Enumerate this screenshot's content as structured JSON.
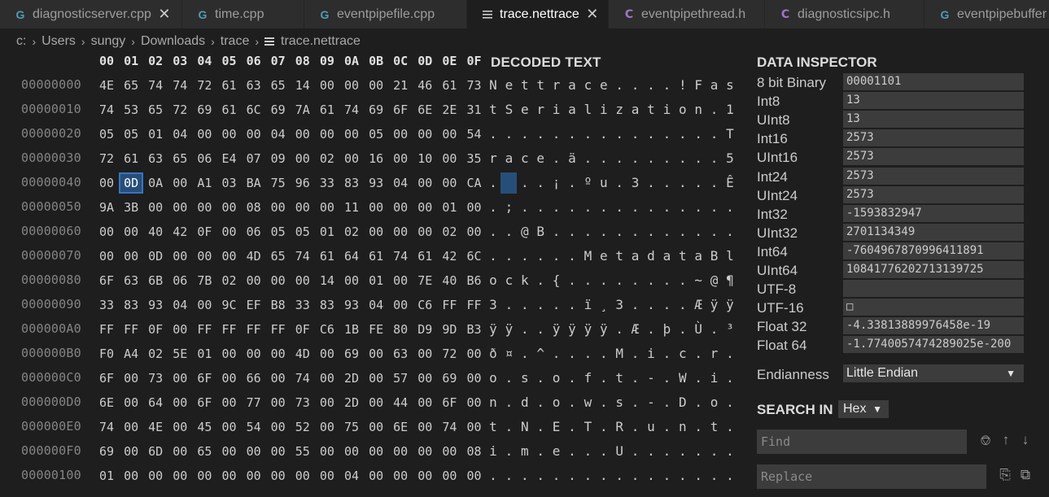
{
  "tabs": [
    {
      "label": "diagnosticserver.cpp",
      "icon": "cpp-file-icon",
      "glyph": "G",
      "closable": true,
      "active": false,
      "width": 224
    },
    {
      "label": "time.cpp",
      "icon": "cpp-file-icon",
      "glyph": "G",
      "closable": false,
      "active": false,
      "width": 150
    },
    {
      "label": "eventpipefile.cpp",
      "icon": "cpp-file-icon",
      "glyph": "G",
      "closable": false,
      "active": false,
      "width": 200
    },
    {
      "label": "trace.nettrace",
      "icon": "lines-file-icon",
      "glyph": "",
      "closable": true,
      "active": true,
      "width": 174
    },
    {
      "label": "eventpipethread.h",
      "icon": "header-file-icon",
      "glyph": "C",
      "closable": false,
      "active": false,
      "width": 192
    },
    {
      "label": "diagnosticsipc.h",
      "icon": "header-file-icon",
      "glyph": "C",
      "closable": false,
      "active": false,
      "width": 196
    },
    {
      "label": "eventpipebuffer",
      "icon": "cpp-file-icon",
      "glyph": "G",
      "closable": false,
      "active": false,
      "width": 160
    }
  ],
  "breadcrumb": [
    "c:",
    "Users",
    "sungy",
    "Downloads",
    "trace",
    "trace.nettrace"
  ],
  "hex": {
    "columns": [
      "00",
      "01",
      "02",
      "03",
      "04",
      "05",
      "06",
      "07",
      "08",
      "09",
      "0A",
      "0B",
      "0C",
      "0D",
      "0E",
      "0F"
    ],
    "selected": {
      "row": 4,
      "col": 1
    },
    "rows": [
      {
        "offset": "00000000",
        "bytes": [
          "4E",
          "65",
          "74",
          "74",
          "72",
          "61",
          "63",
          "65",
          "14",
          "00",
          "00",
          "00",
          "21",
          "46",
          "61",
          "73"
        ]
      },
      {
        "offset": "00000010",
        "bytes": [
          "74",
          "53",
          "65",
          "72",
          "69",
          "61",
          "6C",
          "69",
          "7A",
          "61",
          "74",
          "69",
          "6F",
          "6E",
          "2E",
          "31"
        ]
      },
      {
        "offset": "00000020",
        "bytes": [
          "05",
          "05",
          "01",
          "04",
          "00",
          "00",
          "00",
          "04",
          "00",
          "00",
          "00",
          "05",
          "00",
          "00",
          "00",
          "54"
        ]
      },
      {
        "offset": "00000030",
        "bytes": [
          "72",
          "61",
          "63",
          "65",
          "06",
          "E4",
          "07",
          "09",
          "00",
          "02",
          "00",
          "16",
          "00",
          "10",
          "00",
          "35"
        ]
      },
      {
        "offset": "00000040",
        "bytes": [
          "00",
          "0D",
          "0A",
          "00",
          "A1",
          "03",
          "BA",
          "75",
          "96",
          "33",
          "83",
          "93",
          "04",
          "00",
          "00",
          "CA"
        ]
      },
      {
        "offset": "00000050",
        "bytes": [
          "9A",
          "3B",
          "00",
          "00",
          "00",
          "00",
          "08",
          "00",
          "00",
          "00",
          "11",
          "00",
          "00",
          "00",
          "01",
          "00"
        ]
      },
      {
        "offset": "00000060",
        "bytes": [
          "00",
          "00",
          "40",
          "42",
          "0F",
          "00",
          "06",
          "05",
          "05",
          "01",
          "02",
          "00",
          "00",
          "00",
          "02",
          "00"
        ]
      },
      {
        "offset": "00000070",
        "bytes": [
          "00",
          "00",
          "0D",
          "00",
          "00",
          "00",
          "4D",
          "65",
          "74",
          "61",
          "64",
          "61",
          "74",
          "61",
          "42",
          "6C"
        ]
      },
      {
        "offset": "00000080",
        "bytes": [
          "6F",
          "63",
          "6B",
          "06",
          "7B",
          "02",
          "00",
          "00",
          "00",
          "14",
          "00",
          "01",
          "00",
          "7E",
          "40",
          "B6"
        ]
      },
      {
        "offset": "00000090",
        "bytes": [
          "33",
          "83",
          "93",
          "04",
          "00",
          "9C",
          "EF",
          "B8",
          "33",
          "83",
          "93",
          "04",
          "00",
          "C6",
          "FF",
          "FF"
        ]
      },
      {
        "offset": "000000A0",
        "bytes": [
          "FF",
          "FF",
          "0F",
          "00",
          "FF",
          "FF",
          "FF",
          "FF",
          "0F",
          "C6",
          "1B",
          "FE",
          "80",
          "D9",
          "9D",
          "B3"
        ]
      },
      {
        "offset": "000000B0",
        "bytes": [
          "F0",
          "A4",
          "02",
          "5E",
          "01",
          "00",
          "00",
          "00",
          "4D",
          "00",
          "69",
          "00",
          "63",
          "00",
          "72",
          "00"
        ]
      },
      {
        "offset": "000000C0",
        "bytes": [
          "6F",
          "00",
          "73",
          "00",
          "6F",
          "00",
          "66",
          "00",
          "74",
          "00",
          "2D",
          "00",
          "57",
          "00",
          "69",
          "00"
        ]
      },
      {
        "offset": "000000D0",
        "bytes": [
          "6E",
          "00",
          "64",
          "00",
          "6F",
          "00",
          "77",
          "00",
          "73",
          "00",
          "2D",
          "00",
          "44",
          "00",
          "6F",
          "00"
        ]
      },
      {
        "offset": "000000E0",
        "bytes": [
          "74",
          "00",
          "4E",
          "00",
          "45",
          "00",
          "54",
          "00",
          "52",
          "00",
          "75",
          "00",
          "6E",
          "00",
          "74",
          "00"
        ]
      },
      {
        "offset": "000000F0",
        "bytes": [
          "69",
          "00",
          "6D",
          "00",
          "65",
          "00",
          "00",
          "00",
          "55",
          "00",
          "00",
          "00",
          "00",
          "00",
          "00",
          "08"
        ]
      },
      {
        "offset": "00000100",
        "bytes": [
          "01",
          "00",
          "00",
          "00",
          "00",
          "00",
          "00",
          "00",
          "00",
          "00",
          "04",
          "00",
          "00",
          "00",
          "00",
          "00"
        ]
      }
    ]
  },
  "decoded": {
    "title": "DECODED TEXT",
    "rows": [
      [
        "N",
        "e",
        "t",
        "t",
        "r",
        "a",
        "c",
        "e",
        ".",
        ".",
        ".",
        ".",
        "!",
        "F",
        "a",
        "s"
      ],
      [
        "t",
        "S",
        "e",
        "r",
        "i",
        "a",
        "l",
        "i",
        "z",
        "a",
        "t",
        "i",
        "o",
        "n",
        ".",
        "1"
      ],
      [
        ".",
        ".",
        ".",
        ".",
        ".",
        ".",
        ".",
        ".",
        ".",
        ".",
        ".",
        ".",
        ".",
        ".",
        ".",
        "T"
      ],
      [
        "r",
        "a",
        "c",
        "e",
        ".",
        "ä",
        ".",
        ".",
        ".",
        ".",
        ".",
        ".",
        ".",
        ".",
        ".",
        "5"
      ],
      [
        ".",
        ".",
        ".",
        ".",
        "¡",
        ".",
        "º",
        "u",
        ".",
        "3",
        ".",
        ".",
        ".",
        ".",
        ".",
        "Ê"
      ],
      [
        ".",
        ";",
        ".",
        ".",
        ".",
        ".",
        ".",
        ".",
        ".",
        ".",
        ".",
        ".",
        ".",
        ".",
        ".",
        "."
      ],
      [
        ".",
        ".",
        "@",
        "B",
        ".",
        ".",
        ".",
        ".",
        ".",
        ".",
        ".",
        ".",
        ".",
        ".",
        ".",
        "."
      ],
      [
        ".",
        ".",
        ".",
        ".",
        ".",
        ".",
        "M",
        "e",
        "t",
        "a",
        "d",
        "a",
        "t",
        "a",
        "B",
        "l"
      ],
      [
        "o",
        "c",
        "k",
        ".",
        "{",
        ".",
        ".",
        ".",
        ".",
        ".",
        ".",
        ".",
        ".",
        "~",
        "@",
        "¶"
      ],
      [
        "3",
        ".",
        ".",
        ".",
        ".",
        ".",
        "ï",
        "¸",
        "3",
        ".",
        ".",
        ".",
        ".",
        "Æ",
        "ÿ",
        "ÿ"
      ],
      [
        "ÿ",
        "ÿ",
        ".",
        ".",
        "ÿ",
        "ÿ",
        "ÿ",
        "ÿ",
        ".",
        "Æ",
        ".",
        "þ",
        ".",
        "Ù",
        ".",
        "³"
      ],
      [
        "ð",
        "¤",
        ".",
        "^",
        ".",
        ".",
        ".",
        ".",
        "M",
        ".",
        "i",
        ".",
        "c",
        ".",
        "r",
        "."
      ],
      [
        "o",
        ".",
        "s",
        ".",
        "o",
        ".",
        "f",
        ".",
        "t",
        ".",
        "-",
        ".",
        "W",
        ".",
        "i",
        "."
      ],
      [
        "n",
        ".",
        "d",
        ".",
        "o",
        ".",
        "w",
        ".",
        "s",
        ".",
        "-",
        ".",
        "D",
        ".",
        "o",
        "."
      ],
      [
        "t",
        ".",
        "N",
        ".",
        "E",
        ".",
        "T",
        ".",
        "R",
        ".",
        "u",
        ".",
        "n",
        ".",
        "t",
        "."
      ],
      [
        "i",
        ".",
        "m",
        ".",
        "e",
        ".",
        ".",
        ".",
        "U",
        ".",
        ".",
        ".",
        ".",
        ".",
        ".",
        "."
      ],
      [
        ".",
        ".",
        ".",
        ".",
        ".",
        ".",
        ".",
        ".",
        ".",
        ".",
        ".",
        ".",
        ".",
        ".",
        ".",
        "."
      ]
    ],
    "blanks": [
      [
        4,
        1
      ]
    ]
  },
  "inspector": {
    "title": "DATA INSPECTOR",
    "rows": [
      {
        "label": "8 bit Binary",
        "value": "00001101"
      },
      {
        "label": "Int8",
        "value": "13"
      },
      {
        "label": "UInt8",
        "value": "13"
      },
      {
        "label": "Int16",
        "value": "2573"
      },
      {
        "label": "UInt16",
        "value": "2573"
      },
      {
        "label": "Int24",
        "value": "2573"
      },
      {
        "label": "UInt24",
        "value": "2573"
      },
      {
        "label": "Int32",
        "value": "-1593832947"
      },
      {
        "label": "UInt32",
        "value": "2701134349"
      },
      {
        "label": "Int64",
        "value": "-7604967870996411891"
      },
      {
        "label": "UInt64",
        "value": "10841776202713139725"
      },
      {
        "label": "UTF-8",
        "value": ""
      },
      {
        "label": "UTF-16",
        "value": "□"
      },
      {
        "label": "Float 32",
        "value": "-4.33813889976458e-19"
      },
      {
        "label": "Float 64",
        "value": "-1.7740057474289025e-200"
      }
    ],
    "endianness_label": "Endianness",
    "endianness_value": "Little Endian"
  },
  "search": {
    "title": "SEARCH IN",
    "mode": "Hex",
    "find_placeholder": "Find",
    "replace_placeholder": "Replace"
  },
  "colors": {
    "background": "#1e1e1e",
    "tab_bar": "#252526",
    "inactive_tab": "#2d2d2d",
    "selection": "#264f78",
    "selection_border": "#3a73c4",
    "input_bg": "#3c3c3c",
    "cpp_icon": "#519aba",
    "header_icon": "#a074c4"
  }
}
